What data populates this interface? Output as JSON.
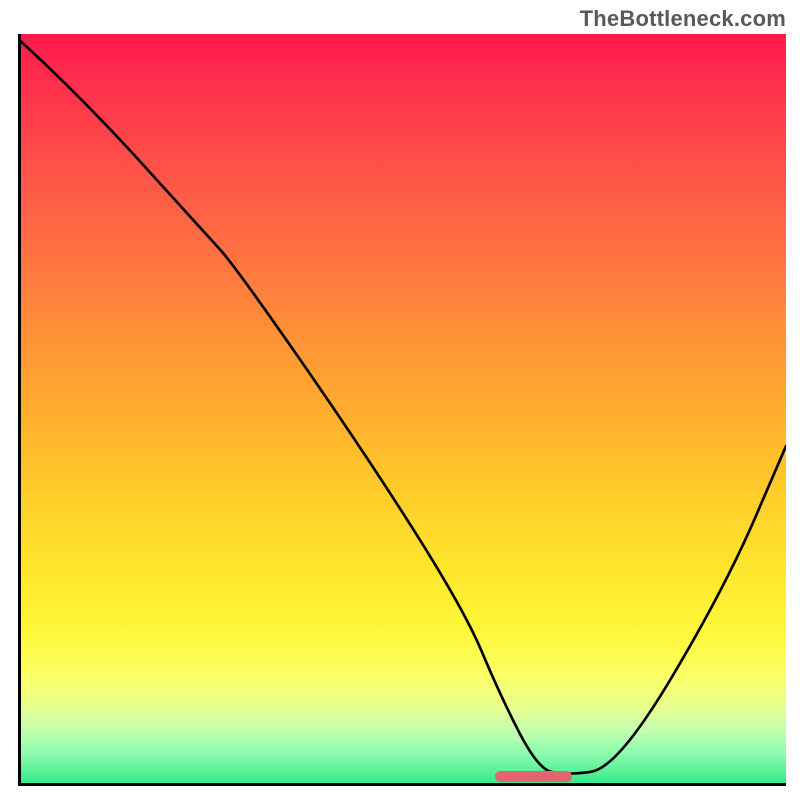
{
  "watermark": "TheBottleneck.com",
  "chart_data": {
    "type": "line",
    "title": "",
    "xlabel": "",
    "ylabel": "",
    "xlim": [
      0,
      100
    ],
    "ylim": [
      0,
      100
    ],
    "grid": false,
    "legend": false,
    "series": [
      {
        "name": "bottleneck-curve",
        "x": [
          0,
          8,
          24,
          28,
          45,
          58,
          62.5,
          67.5,
          71,
          78,
          92,
          100
        ],
        "values": [
          99,
          91.5,
          73.5,
          69,
          44,
          23,
          12,
          2,
          1,
          2,
          26,
          45
        ]
      }
    ],
    "marker": {
      "x_start": 62,
      "x_end": 72,
      "y": 1,
      "color": "#e06670"
    },
    "gradient_note": "background heatmap: red (worst) → yellow → green (best)"
  }
}
